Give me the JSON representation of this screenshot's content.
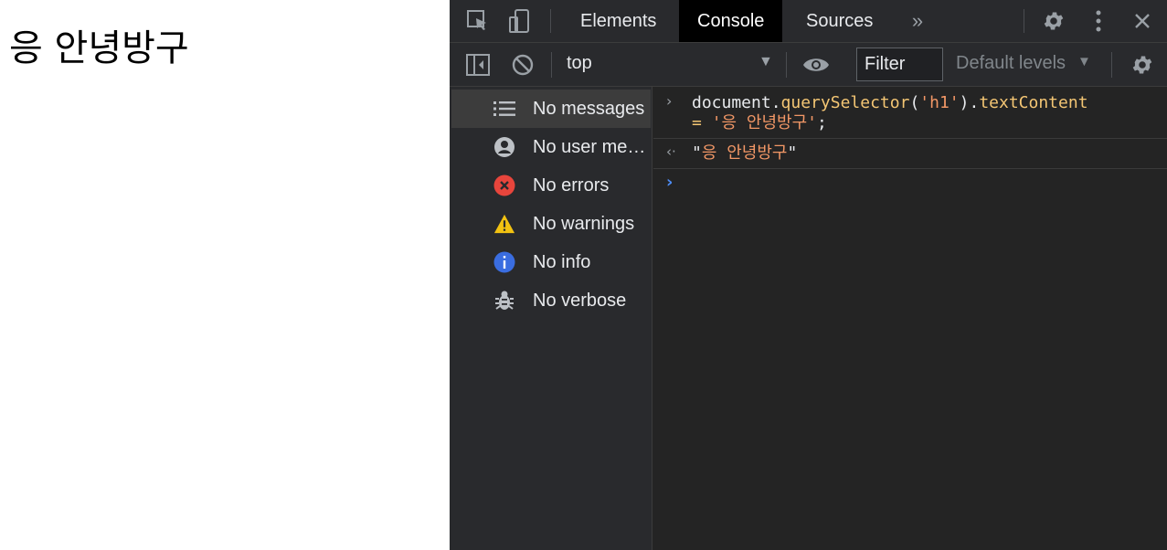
{
  "page": {
    "heading": "응 안녕방구"
  },
  "devtools": {
    "tabs": [
      "Elements",
      "Console",
      "Sources"
    ],
    "active_tab": "Console",
    "toolbar": {
      "context": "top",
      "filter_placeholder": "Filter",
      "levels": "Default levels"
    },
    "sidebar": [
      {
        "label": "No messages",
        "icon": "list-icon"
      },
      {
        "label": "No user me…",
        "icon": "user-icon"
      },
      {
        "label": "No errors",
        "icon": "error-icon",
        "color": "#e8453c"
      },
      {
        "label": "No warnings",
        "icon": "warning-icon",
        "color": "#f2c211"
      },
      {
        "label": "No info",
        "icon": "info-icon",
        "color": "#3a6de0"
      },
      {
        "label": "No verbose",
        "icon": "bug-icon"
      }
    ],
    "console": {
      "input": {
        "obj": "document.",
        "method": "querySelector",
        "open": "(",
        "arg": "'h1'",
        "close": ").",
        "prop": "textContent",
        "eq": "= ",
        "value": "'응 안녕방구'",
        "end": ";"
      },
      "output": {
        "quote_open": "\"",
        "value": "응 안녕방구",
        "quote_close": "\""
      }
    },
    "colors": {
      "background": "#242424",
      "panel": "#292a2d",
      "string": "#f29766",
      "function": "#f4c674",
      "prompt": "#4d8cf5"
    }
  }
}
